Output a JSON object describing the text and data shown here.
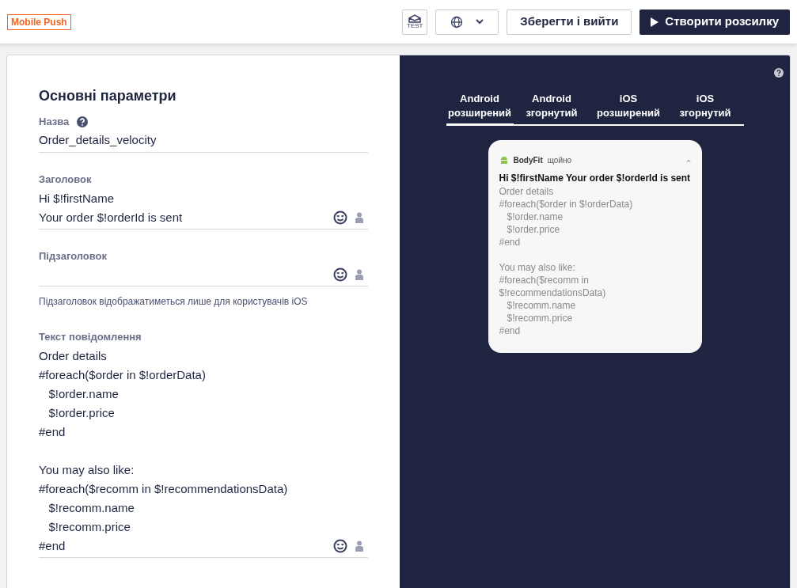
{
  "header": {
    "badge": "Mobile Push",
    "test_label": "TEST",
    "save_button": "Зберегти і вийти",
    "create_button": "Створити розсилку"
  },
  "form": {
    "title": "Основні параметри",
    "name_field": {
      "label": "Назва",
      "value": "Order_details_velocity"
    },
    "title_field": {
      "label": "Заголовок",
      "lines": [
        "Hi $!firstName",
        "Your order $!orderId is sent"
      ]
    },
    "subtitle_field": {
      "label": "Підзаголовок",
      "hint": "Підзаголовок відображатиметься лише для користувачів iOS"
    },
    "message_field": {
      "label": "Текст повідомлення",
      "blocks": [
        [
          "Order details",
          "#foreach($order in $!orderData)",
          "   $!order.name",
          "   $!order.price",
          "#end"
        ],
        [
          "You may also like:",
          "#foreach($recomm in $!recommendationsData)",
          "   $!recomm.name",
          "   $!recomm.price",
          "#end"
        ]
      ]
    }
  },
  "preview": {
    "tabs": [
      {
        "line1": "Android",
        "line2": "розширений",
        "selected": true
      },
      {
        "line1": "Android",
        "line2": "згорнутий",
        "selected": false
      },
      {
        "line1": "iOS",
        "line2": "розширений",
        "selected": false
      },
      {
        "line1": "iOS",
        "line2": "згорнутий",
        "selected": false
      }
    ],
    "notification": {
      "app": "BodyFit",
      "time": "щойно",
      "title": "Hi $!firstName Your order $!orderId is sent",
      "blocks": [
        [
          "Order details",
          "#foreach($order in $!orderData)",
          "   $!order.name",
          "   $!order.price",
          "#end"
        ],
        [
          "You may also like:",
          "#foreach($recomm in",
          "$!recommendationsData)",
          "   $!recomm.name",
          "   $!recomm.price",
          "#end"
        ]
      ]
    }
  }
}
